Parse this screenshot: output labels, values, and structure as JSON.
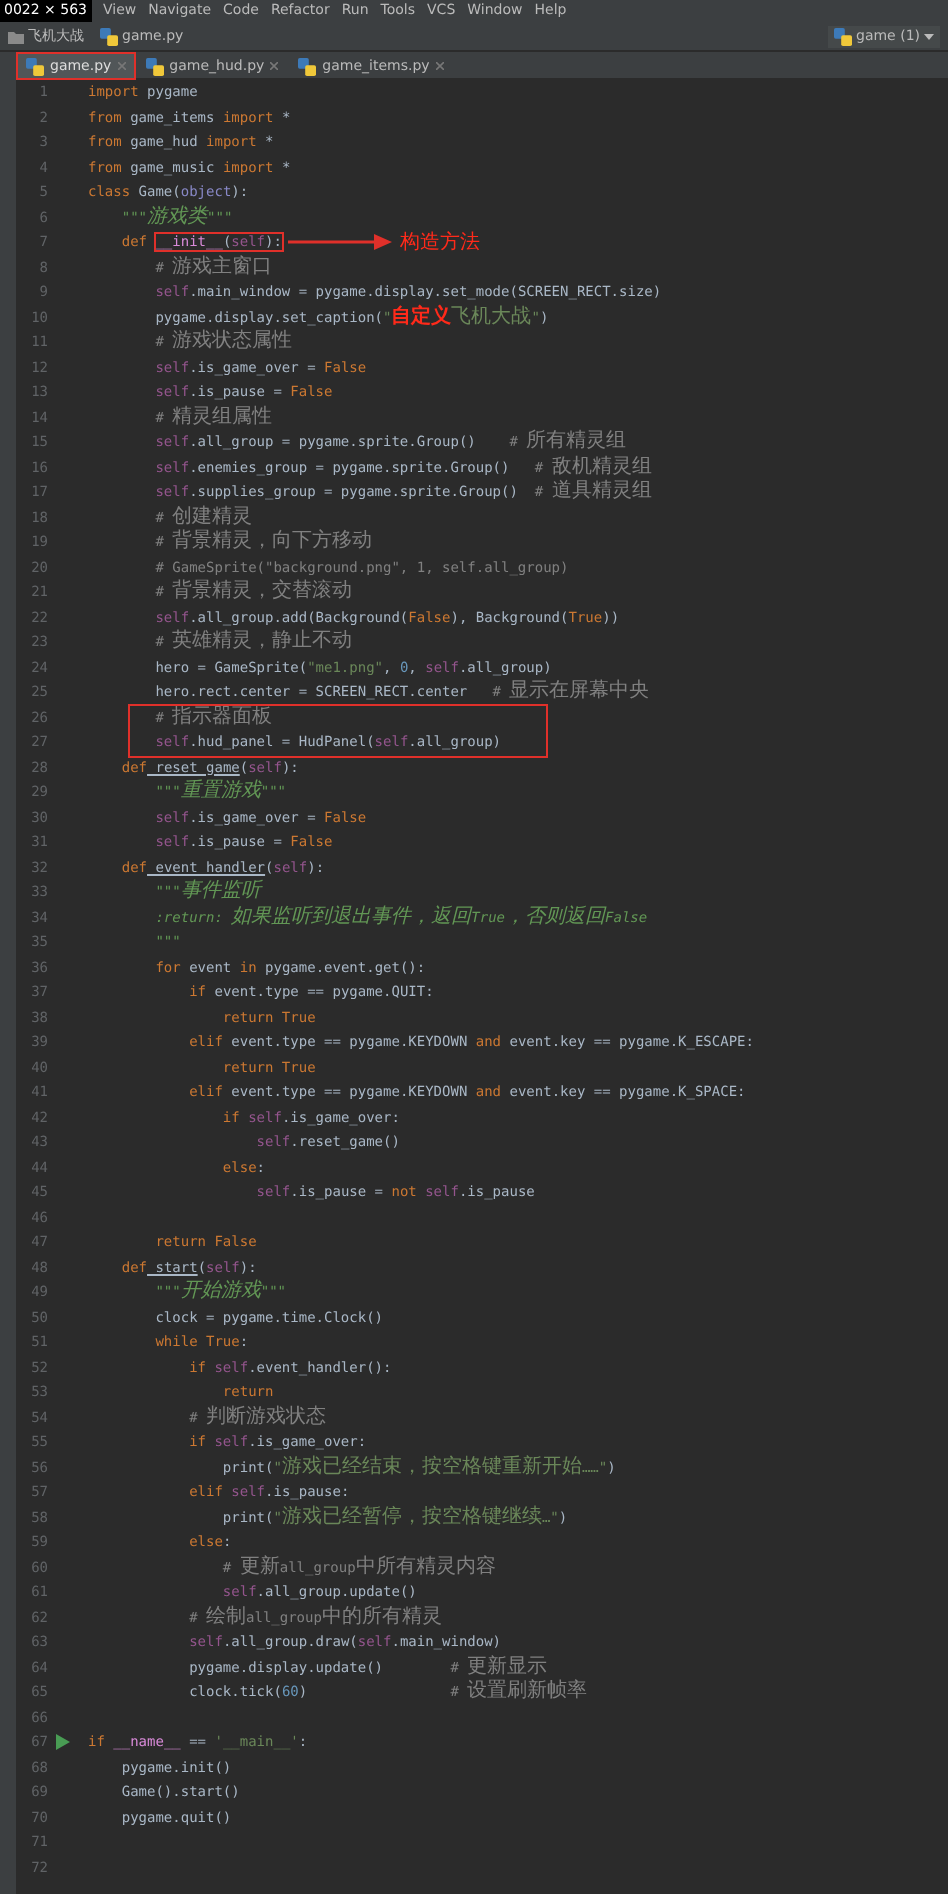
{
  "size_label": "0022 × 563",
  "menu": [
    "View",
    "Navigate",
    "Code",
    "Refactor",
    "Run",
    "Tools",
    "VCS",
    "Window",
    "Help"
  ],
  "breadcrumbs": [
    {
      "text": "飞机大战",
      "kind": "folder"
    },
    {
      "text": "game.py",
      "kind": "file"
    }
  ],
  "run_config": "game (1)",
  "tabs": [
    {
      "label": "game.py",
      "selected": true,
      "highlighted": true
    },
    {
      "label": "game_hud.py",
      "selected": false,
      "highlighted": false
    },
    {
      "label": "game_items.py",
      "selected": false,
      "highlighted": false
    }
  ],
  "lines": [
    {
      "number": "1",
      "tokens": [
        {
          "kind": "kw",
          "text": "import"
        },
        {
          "kind": "plain",
          "text": " pygame"
        }
      ]
    },
    {
      "number": "2",
      "tokens": [
        {
          "kind": "kw",
          "text": "from"
        },
        {
          "kind": "plain",
          "text": " game_items "
        },
        {
          "kind": "kw",
          "text": "import"
        },
        {
          "kind": "plain",
          "text": " *"
        }
      ]
    },
    {
      "number": "3",
      "tokens": [
        {
          "kind": "kw",
          "text": "from"
        },
        {
          "kind": "plain",
          "text": " game_hud "
        },
        {
          "kind": "kw",
          "text": "import"
        },
        {
          "kind": "plain",
          "text": " *"
        }
      ]
    },
    {
      "number": "4",
      "tokens": [
        {
          "kind": "kw",
          "text": "from"
        },
        {
          "kind": "plain",
          "text": " game_music "
        },
        {
          "kind": "kw",
          "text": "import"
        },
        {
          "kind": "plain",
          "text": " *"
        }
      ]
    },
    {
      "number": "5",
      "tokens": [
        {
          "kind": "kw",
          "text": "class"
        },
        {
          "kind": "plain",
          "text": " Game("
        },
        {
          "kind": "builtin",
          "text": "object"
        },
        {
          "kind": "plain",
          "text": "):"
        }
      ]
    },
    {
      "number": "6",
      "tokens": [
        {
          "kind": "doc",
          "text": "    \"\"\"游戏类\"\"\""
        }
      ]
    },
    {
      "number": "7",
      "tokens": [
        {
          "kind": "kw",
          "text": "    def "
        },
        {
          "kind": "magic",
          "text": "__init__",
          "boxed": true
        },
        {
          "kind": "plain",
          "text": "(",
          "boxed": true
        },
        {
          "kind": "self",
          "text": "self",
          "boxed": true
        },
        {
          "kind": "plain",
          "text": "):",
          "boxed": true
        }
      ],
      "callout": "构造方法"
    },
    {
      "number": "8",
      "tokens": [
        {
          "kind": "comment",
          "text": "        # 游戏主窗口"
        }
      ]
    },
    {
      "number": "9",
      "tokens": [
        {
          "kind": "self",
          "text": "        self"
        },
        {
          "kind": "plain",
          "text": ".main_window = pygame.display.set_mode(SCREEN_RECT.size)"
        }
      ]
    },
    {
      "number": "10",
      "tokens": [
        {
          "kind": "plain",
          "text": "        pygame.display.set_caption("
        },
        {
          "kind": "string",
          "text": "\""
        },
        {
          "kind": "mark",
          "text": "自定义"
        },
        {
          "kind": "string",
          "text": "飞机大战\""
        },
        {
          "kind": "plain",
          "text": ")"
        }
      ]
    },
    {
      "number": "11",
      "tokens": [
        {
          "kind": "comment",
          "text": "        # 游戏状态属性"
        }
      ]
    },
    {
      "number": "12",
      "tokens": [
        {
          "kind": "self",
          "text": "        self"
        },
        {
          "kind": "plain",
          "text": ".is_game_over = "
        },
        {
          "kind": "kw",
          "text": "False"
        }
      ]
    },
    {
      "number": "13",
      "tokens": [
        {
          "kind": "self",
          "text": "        self"
        },
        {
          "kind": "plain",
          "text": ".is_pause = "
        },
        {
          "kind": "kw",
          "text": "False"
        }
      ]
    },
    {
      "number": "14",
      "tokens": [
        {
          "kind": "comment",
          "text": "        # 精灵组属性"
        }
      ]
    },
    {
      "number": "15",
      "tokens": [
        {
          "kind": "self",
          "text": "        self"
        },
        {
          "kind": "plain",
          "text": ".all_group = pygame.sprite.Group()    "
        },
        {
          "kind": "comment",
          "text": "# 所有精灵组"
        }
      ]
    },
    {
      "number": "16",
      "tokens": [
        {
          "kind": "self",
          "text": "        self"
        },
        {
          "kind": "plain",
          "text": ".enemies_group = pygame.sprite.Group()   "
        },
        {
          "kind": "comment",
          "text": "# 敌机精灵组"
        }
      ]
    },
    {
      "number": "17",
      "tokens": [
        {
          "kind": "self",
          "text": "        self"
        },
        {
          "kind": "plain",
          "text": ".supplies_group = pygame.sprite.Group()  "
        },
        {
          "kind": "comment",
          "text": "# 道具精灵组"
        }
      ]
    },
    {
      "number": "18",
      "tokens": [
        {
          "kind": "comment",
          "text": "        # 创建精灵"
        }
      ]
    },
    {
      "number": "19",
      "tokens": [
        {
          "kind": "comment",
          "text": "        # 背景精灵，向下方移动"
        }
      ]
    },
    {
      "number": "20",
      "tokens": [
        {
          "kind": "comment",
          "text": "        # GameSprite(\"background.png\", 1, self.all_group)"
        }
      ]
    },
    {
      "number": "21",
      "tokens": [
        {
          "kind": "comment",
          "text": "        # 背景精灵，交替滚动"
        }
      ]
    },
    {
      "number": "22",
      "tokens": [
        {
          "kind": "self",
          "text": "        self"
        },
        {
          "kind": "plain",
          "text": ".all_group.add(Background("
        },
        {
          "kind": "kw",
          "text": "False"
        },
        {
          "kind": "plain",
          "text": "), Background("
        },
        {
          "kind": "kw",
          "text": "True"
        },
        {
          "kind": "plain",
          "text": "))"
        }
      ]
    },
    {
      "number": "23",
      "tokens": [
        {
          "kind": "comment",
          "text": "        # 英雄精灵，静止不动"
        }
      ]
    },
    {
      "number": "24",
      "tokens": [
        {
          "kind": "plain",
          "text": "        hero = GameSprite("
        },
        {
          "kind": "string",
          "text": "\"me1.png\""
        },
        {
          "kind": "plain",
          "text": ", "
        },
        {
          "kind": "number",
          "text": "0"
        },
        {
          "kind": "plain",
          "text": ", "
        },
        {
          "kind": "self",
          "text": "self"
        },
        {
          "kind": "plain",
          "text": ".all_group)"
        }
      ]
    },
    {
      "number": "25",
      "tokens": [
        {
          "kind": "plain",
          "text": "        hero.rect.center = SCREEN_RECT.center   "
        },
        {
          "kind": "comment",
          "text": "# 显示在屏幕中央"
        }
      ]
    },
    {
      "number": "26",
      "boxed": true,
      "tokens": [
        {
          "kind": "comment",
          "text": "        # 指示器面板"
        }
      ]
    },
    {
      "number": "27",
      "boxed": true,
      "tokens": [
        {
          "kind": "self",
          "text": "        self"
        },
        {
          "kind": "plain",
          "text": ".hud_panel = HudPanel("
        },
        {
          "kind": "self",
          "text": "self"
        },
        {
          "kind": "plain",
          "text": ".all_group)"
        }
      ]
    },
    {
      "number": "28",
      "tokens": [
        {
          "kind": "kw",
          "text": "    def"
        },
        {
          "kind": "func",
          "text": " reset_game"
        },
        {
          "kind": "plain",
          "text": "("
        },
        {
          "kind": "self",
          "text": "self"
        },
        {
          "kind": "plain",
          "text": "):"
        }
      ]
    },
    {
      "number": "29",
      "tokens": [
        {
          "kind": "doc",
          "text": "        \"\"\"重置游戏\"\"\""
        }
      ]
    },
    {
      "number": "30",
      "tokens": [
        {
          "kind": "self",
          "text": "        self"
        },
        {
          "kind": "plain",
          "text": ".is_game_over = "
        },
        {
          "kind": "kw",
          "text": "False"
        }
      ]
    },
    {
      "number": "31",
      "tokens": [
        {
          "kind": "self",
          "text": "        self"
        },
        {
          "kind": "plain",
          "text": ".is_pause = "
        },
        {
          "kind": "kw",
          "text": "False"
        }
      ]
    },
    {
      "number": "32",
      "tokens": [
        {
          "kind": "kw",
          "text": "    def"
        },
        {
          "kind": "func",
          "text": " event_handler"
        },
        {
          "kind": "plain",
          "text": "("
        },
        {
          "kind": "self",
          "text": "self"
        },
        {
          "kind": "plain",
          "text": "):"
        }
      ]
    },
    {
      "number": "33",
      "tokens": [
        {
          "kind": "doc",
          "text": "        \"\"\"事件监听"
        }
      ]
    },
    {
      "number": "34",
      "tokens": [
        {
          "kind": "doc",
          "text": "        :return: 如果监听到退出事件，返回True，否则返回False"
        }
      ]
    },
    {
      "number": "35",
      "tokens": [
        {
          "kind": "doc",
          "text": "        \"\"\""
        }
      ]
    },
    {
      "number": "36",
      "tokens": [
        {
          "kind": "kw",
          "text": "        for"
        },
        {
          "kind": "plain",
          "text": " event "
        },
        {
          "kind": "kw",
          "text": "in"
        },
        {
          "kind": "plain",
          "text": " pygame.event.get():"
        }
      ]
    },
    {
      "number": "37",
      "tokens": [
        {
          "kind": "kw",
          "text": "            if"
        },
        {
          "kind": "plain",
          "text": " event.type == pygame.QUIT:"
        }
      ]
    },
    {
      "number": "38",
      "tokens": [
        {
          "kind": "kw",
          "text": "                return True"
        }
      ]
    },
    {
      "number": "39",
      "tokens": [
        {
          "kind": "kw",
          "text": "            elif"
        },
        {
          "kind": "plain",
          "text": " event.type == pygame.KEYDOWN "
        },
        {
          "kind": "kw",
          "text": "and"
        },
        {
          "kind": "plain",
          "text": " event.key == pygame.K_ESCAPE:"
        }
      ]
    },
    {
      "number": "40",
      "tokens": [
        {
          "kind": "kw",
          "text": "                return True"
        }
      ]
    },
    {
      "number": "41",
      "tokens": [
        {
          "kind": "kw",
          "text": "            elif"
        },
        {
          "kind": "plain",
          "text": " event.type == pygame.KEYDOWN "
        },
        {
          "kind": "kw",
          "text": "and"
        },
        {
          "kind": "plain",
          "text": " event.key == pygame.K_SPACE:"
        }
      ]
    },
    {
      "number": "42",
      "tokens": [
        {
          "kind": "kw",
          "text": "                if "
        },
        {
          "kind": "self",
          "text": "self"
        },
        {
          "kind": "plain",
          "text": ".is_game_over:"
        }
      ]
    },
    {
      "number": "43",
      "tokens": [
        {
          "kind": "self",
          "text": "                    self"
        },
        {
          "kind": "plain",
          "text": ".reset_game()"
        }
      ]
    },
    {
      "number": "44",
      "tokens": [
        {
          "kind": "kw",
          "text": "                else"
        },
        {
          "kind": "plain",
          "text": ":"
        }
      ]
    },
    {
      "number": "45",
      "tokens": [
        {
          "kind": "self",
          "text": "                    self"
        },
        {
          "kind": "plain",
          "text": ".is_pause = "
        },
        {
          "kind": "kw",
          "text": "not "
        },
        {
          "kind": "self",
          "text": "self"
        },
        {
          "kind": "plain",
          "text": ".is_pause"
        }
      ]
    },
    {
      "number": "46"
    },
    {
      "number": "47",
      "tokens": [
        {
          "kind": "kw",
          "text": "        return False"
        }
      ]
    },
    {
      "number": "48",
      "tokens": [
        {
          "kind": "kw",
          "text": "    def"
        },
        {
          "kind": "func",
          "text": " start"
        },
        {
          "kind": "plain",
          "text": "("
        },
        {
          "kind": "self",
          "text": "self"
        },
        {
          "kind": "plain",
          "text": "):"
        }
      ]
    },
    {
      "number": "49",
      "tokens": [
        {
          "kind": "doc",
          "text": "        \"\"\"开始游戏\"\"\""
        }
      ]
    },
    {
      "number": "50",
      "tokens": [
        {
          "kind": "plain",
          "text": "        clock = pygame.time.Clock()"
        }
      ]
    },
    {
      "number": "51",
      "tokens": [
        {
          "kind": "kw",
          "text": "        while True"
        },
        {
          "kind": "plain",
          "text": ":"
        }
      ]
    },
    {
      "number": "52",
      "tokens": [
        {
          "kind": "kw",
          "text": "            if "
        },
        {
          "kind": "self",
          "text": "self"
        },
        {
          "kind": "plain",
          "text": ".event_handler():"
        }
      ]
    },
    {
      "number": "53",
      "tokens": [
        {
          "kind": "kw",
          "text": "                return"
        }
      ]
    },
    {
      "number": "54",
      "tokens": [
        {
          "kind": "comment",
          "text": "            # 判断游戏状态"
        }
      ]
    },
    {
      "number": "55",
      "tokens": [
        {
          "kind": "kw",
          "text": "            if "
        },
        {
          "kind": "self",
          "text": "self"
        },
        {
          "kind": "plain",
          "text": ".is_game_over:"
        }
      ]
    },
    {
      "number": "56",
      "tokens": [
        {
          "kind": "plain",
          "text": "                print("
        },
        {
          "kind": "string",
          "text": "\"游戏已经结束，按空格键重新开始……\""
        },
        {
          "kind": "plain",
          "text": ")"
        }
      ]
    },
    {
      "number": "57",
      "tokens": [
        {
          "kind": "kw",
          "text": "            elif "
        },
        {
          "kind": "self",
          "text": "self"
        },
        {
          "kind": "plain",
          "text": ".is_pause:"
        }
      ]
    },
    {
      "number": "58",
      "tokens": [
        {
          "kind": "plain",
          "text": "                print("
        },
        {
          "kind": "string",
          "text": "\"游戏已经暂停，按空格键继续…\""
        },
        {
          "kind": "plain",
          "text": ")"
        }
      ]
    },
    {
      "number": "59",
      "tokens": [
        {
          "kind": "kw",
          "text": "            else"
        },
        {
          "kind": "plain",
          "text": ":"
        }
      ]
    },
    {
      "number": "60",
      "tokens": [
        {
          "kind": "comment",
          "text": "                # 更新all_group中所有精灵内容"
        }
      ]
    },
    {
      "number": "61",
      "tokens": [
        {
          "kind": "self",
          "text": "                self"
        },
        {
          "kind": "plain",
          "text": ".all_group.update()"
        }
      ]
    },
    {
      "number": "62",
      "tokens": [
        {
          "kind": "comment",
          "text": "            # 绘制all_group中的所有精灵"
        }
      ]
    },
    {
      "number": "63",
      "tokens": [
        {
          "kind": "self",
          "text": "            self"
        },
        {
          "kind": "plain",
          "text": ".all_group.draw("
        },
        {
          "kind": "self",
          "text": "self"
        },
        {
          "kind": "plain",
          "text": ".main_window)"
        }
      ]
    },
    {
      "number": "64",
      "tokens": [
        {
          "kind": "plain",
          "text": "            pygame.display.update()        "
        },
        {
          "kind": "comment",
          "text": "# 更新显示"
        }
      ]
    },
    {
      "number": "65",
      "tokens": [
        {
          "kind": "plain",
          "text": "            clock.tick("
        },
        {
          "kind": "number",
          "text": "60"
        },
        {
          "kind": "plain",
          "text": ")                 "
        },
        {
          "kind": "comment",
          "text": "# 设置刷新帧率"
        }
      ]
    },
    {
      "number": "66"
    },
    {
      "number": "67",
      "run_marker": true,
      "tokens": [
        {
          "kind": "kw",
          "text": "if "
        },
        {
          "kind": "magic",
          "text": "__name__"
        },
        {
          "kind": "plain",
          "text": " == "
        },
        {
          "kind": "string",
          "text": "'__main__'"
        },
        {
          "kind": "plain",
          "text": ":"
        }
      ]
    },
    {
      "number": "68",
      "tokens": [
        {
          "kind": "plain",
          "text": "    pygame.init()"
        }
      ]
    },
    {
      "number": "69",
      "tokens": [
        {
          "kind": "plain",
          "text": "    Game().start()"
        }
      ]
    },
    {
      "number": "70",
      "tokens": [
        {
          "kind": "plain",
          "text": "    pygame.quit()"
        }
      ]
    },
    {
      "number": "71"
    },
    {
      "number": "72"
    }
  ]
}
